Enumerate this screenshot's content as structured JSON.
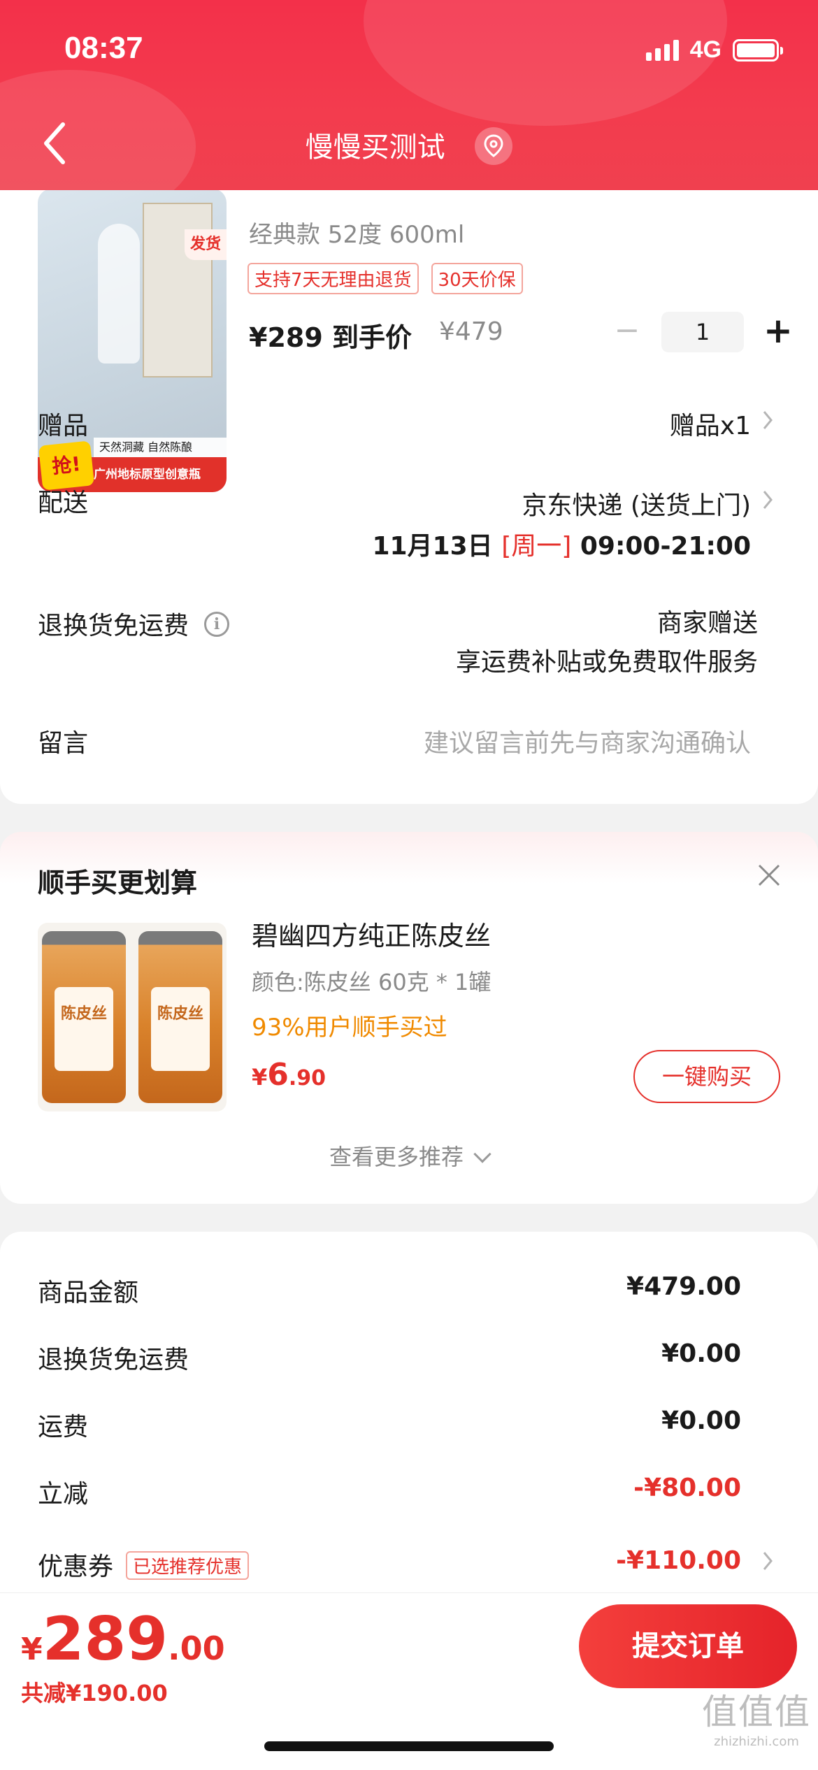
{
  "status_bar": {
    "time": "08:37",
    "network": "4G"
  },
  "nav": {
    "title": "慢慢买测试"
  },
  "product": {
    "image_badge": "发货",
    "image_grab": "抢!",
    "image_sub": "天然洞藏 自然陈酿",
    "image_banner": "广州地标原型创意瓶",
    "spec": "经典款 52度 600ml",
    "badges": [
      "支持7天无理由退货",
      "30天价保"
    ],
    "price_now": "¥289 到手价",
    "price_original": "¥479",
    "quantity": "1"
  },
  "rows": {
    "gift": {
      "label": "赠品",
      "value": "赠品x1"
    },
    "delivery": {
      "label": "配送",
      "value": "京东快递 (送货上门)",
      "date": "11月13日",
      "weekday": "[周一]",
      "time": "09:00-21:00"
    },
    "return_shipping": {
      "label": "退换货免运费",
      "value_line1": "商家赠送",
      "value_line2": "享运费补贴或免费取件服务"
    },
    "message": {
      "label": "留言",
      "placeholder": "建议留言前先与商家沟通确认"
    }
  },
  "recommend": {
    "title": "顺手买更划算",
    "name": "碧幽四方纯正陈皮丝",
    "spec": "颜色:陈皮丝 60克 * 1罐",
    "percent_text": "93%用户顺手买过",
    "price_symbol": "¥",
    "price_int": "6",
    "price_dec": ".90",
    "buy_label": "一键购买",
    "more_label": "查看更多推荐",
    "jar_label": "陈皮丝"
  },
  "summary": {
    "items": [
      {
        "label": "商品金额",
        "value": "¥479.00"
      },
      {
        "label": "退换货免运费",
        "value": "¥0.00"
      },
      {
        "label": "运费",
        "value": "¥0.00"
      },
      {
        "label": "立减",
        "value": "-¥80.00"
      },
      {
        "label": "优惠券",
        "value": "-¥110.00",
        "tag": "已选推荐优惠"
      }
    ]
  },
  "bottom": {
    "total_symbol": "¥",
    "total_int": "289",
    "total_dec": ".00",
    "saved": "共减¥190.00",
    "submit_label": "提交订单"
  },
  "watermark": {
    "logo": "值值值",
    "url": "zhizhizhi.com"
  },
  "colors": {
    "brand_red": "#e5302b",
    "header_red": "#f3304a",
    "orange": "#f08a00"
  }
}
